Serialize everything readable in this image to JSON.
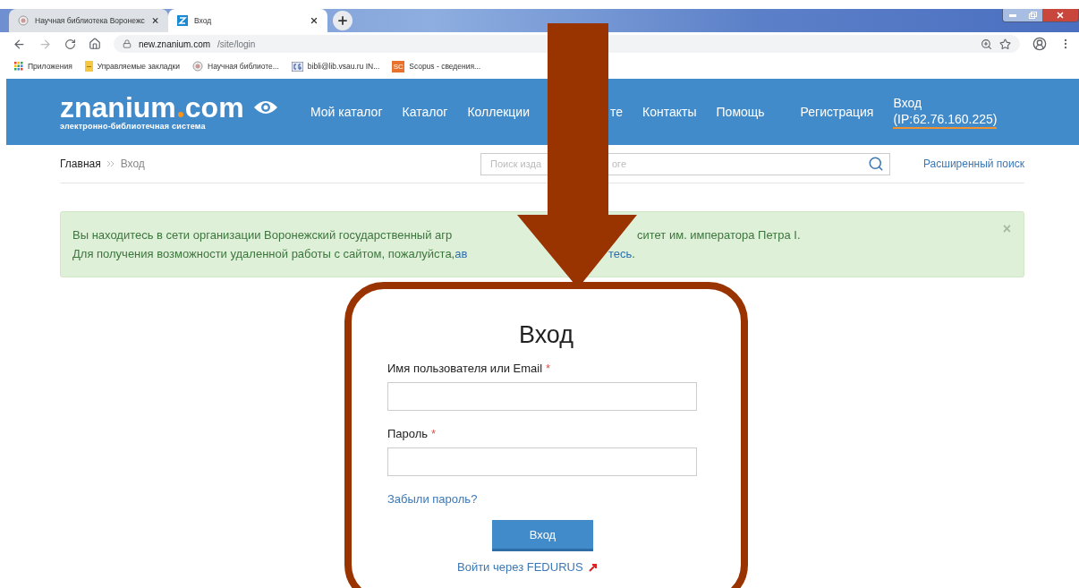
{
  "browser": {
    "tabs": [
      {
        "title": "Научная библиотека Воронежс",
        "kind": "library",
        "selected": false
      },
      {
        "title": "Вход",
        "kind": "znanium",
        "selected": true
      }
    ],
    "url_host": "new.znanium.com",
    "url_path": "/site/login",
    "bookmarks": [
      {
        "label": "Приложения",
        "kind": "apps"
      },
      {
        "label": "Управляемые закладки",
        "kind": "folder"
      },
      {
        "label": "Научная библиоте...",
        "kind": "library"
      },
      {
        "label": "bibli@lib.vsau.ru IN...",
        "kind": "cg"
      },
      {
        "label": "Scopus - сведения...",
        "kind": "scopus",
        "icon_text": "SC"
      }
    ]
  },
  "site": {
    "logo_left": "znanium",
    "logo_right": "com",
    "logo_subtitle": "электронно-библиотечная система",
    "nav": [
      {
        "label": "Мой каталог"
      },
      {
        "label": "Каталог"
      },
      {
        "label": "Коллекции"
      },
      {
        "label": "те"
      },
      {
        "label": "Контакты"
      },
      {
        "label": "Помощь"
      }
    ],
    "register": "Регистрация",
    "login": "Вход",
    "ip": "(IP:62.76.160.225)",
    "breadcrumbs": [
      {
        "label": "Главная"
      },
      {
        "label": "Вход"
      }
    ],
    "search": {
      "placeholder": "Поиск изда",
      "placeholder_tail": "оге"
    },
    "advanced_search": "Расширенный поиск",
    "alert": {
      "line1_start": "Вы находитесь в сети организации Воронежский государственный агр",
      "line1_end": "ситет им. императора Петра I.",
      "line2_start": "Для получения возможности удаленной работы с сайтом, пожалуйста, ",
      "line2_link_start": "ав",
      "line2_link_end": "тесь",
      "line2_end": ".",
      "close": "×"
    },
    "login_form": {
      "title": "Вход",
      "username_label": "Имя пользователя или Email",
      "password_label": "Пароль",
      "required_mark": "*",
      "forgot": "Забыли пароль?",
      "submit": "Вход",
      "fedurus": "Войти через FEDURUS"
    }
  }
}
